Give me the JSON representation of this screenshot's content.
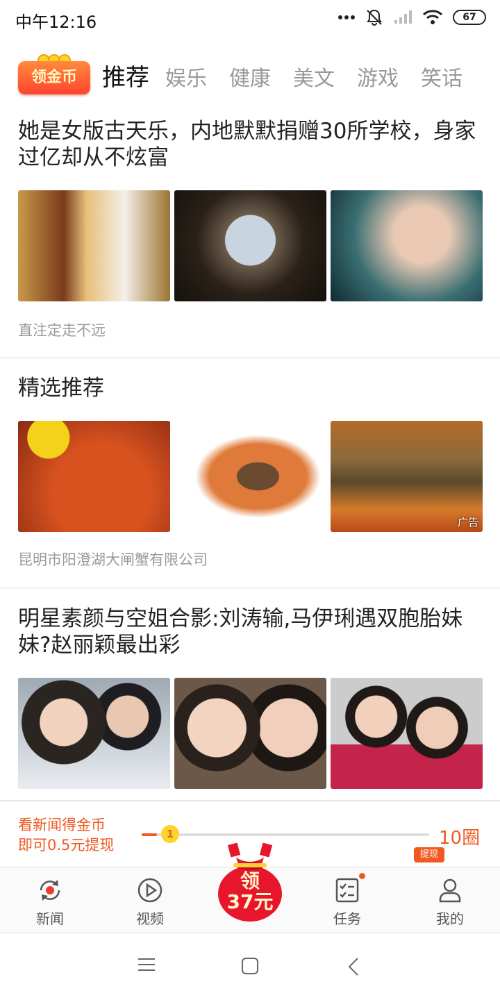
{
  "status_bar": {
    "time": "中午12:16",
    "battery": "67",
    "icons": [
      "more-dots-icon",
      "mute-bell-icon",
      "signal-icon",
      "wifi-icon",
      "battery-icon"
    ]
  },
  "top_tabs": {
    "coin_button": "领金币",
    "tabs": [
      "推荐",
      "娱乐",
      "健康",
      "美文",
      "游戏",
      "笑话"
    ],
    "active_tab": "推荐"
  },
  "feed": [
    {
      "title": "她是女版古天乐，内地默默捐赠30所学校，身家过亿却从不炫富",
      "source": "直注定走不远",
      "images": [
        "photo-child-gold-dress",
        "photo-library-portrait",
        "photo-woman-teal"
      ]
    },
    {
      "title": "精选推荐",
      "source": "昆明市阳澄湖大闸蟹有限公司",
      "ad_label": "广告",
      "images": [
        "photo-crabs-flowers",
        "photo-crab-plate",
        "photo-crab-tied"
      ]
    },
    {
      "title": "明星素颜与空姐合影:刘涛输,马伊琍遇双胞胎妹妹?赵丽颖最出彩",
      "images": [
        "photo-couple-pilot",
        "photo-two-women",
        "photo-short-hair-women"
      ]
    }
  ],
  "reward_bar": {
    "line1": "看新闻得金币",
    "line2": "即可0.5元提现",
    "progress_value": "1",
    "progress_fraction": 0.02,
    "laps": "10圈",
    "withdraw": "提现"
  },
  "bottom_nav": {
    "items": [
      {
        "label": "新闻",
        "icon": "news-refresh-icon"
      },
      {
        "label": "视频",
        "icon": "video-play-icon"
      },
      {
        "label": "任务",
        "icon": "task-checklist-icon"
      },
      {
        "label": "我的",
        "icon": "profile-icon"
      }
    ],
    "center": {
      "line1": "领",
      "line2": "37元"
    }
  },
  "colors": {
    "accent": "#f05a22",
    "coin": "#ffd22e"
  }
}
